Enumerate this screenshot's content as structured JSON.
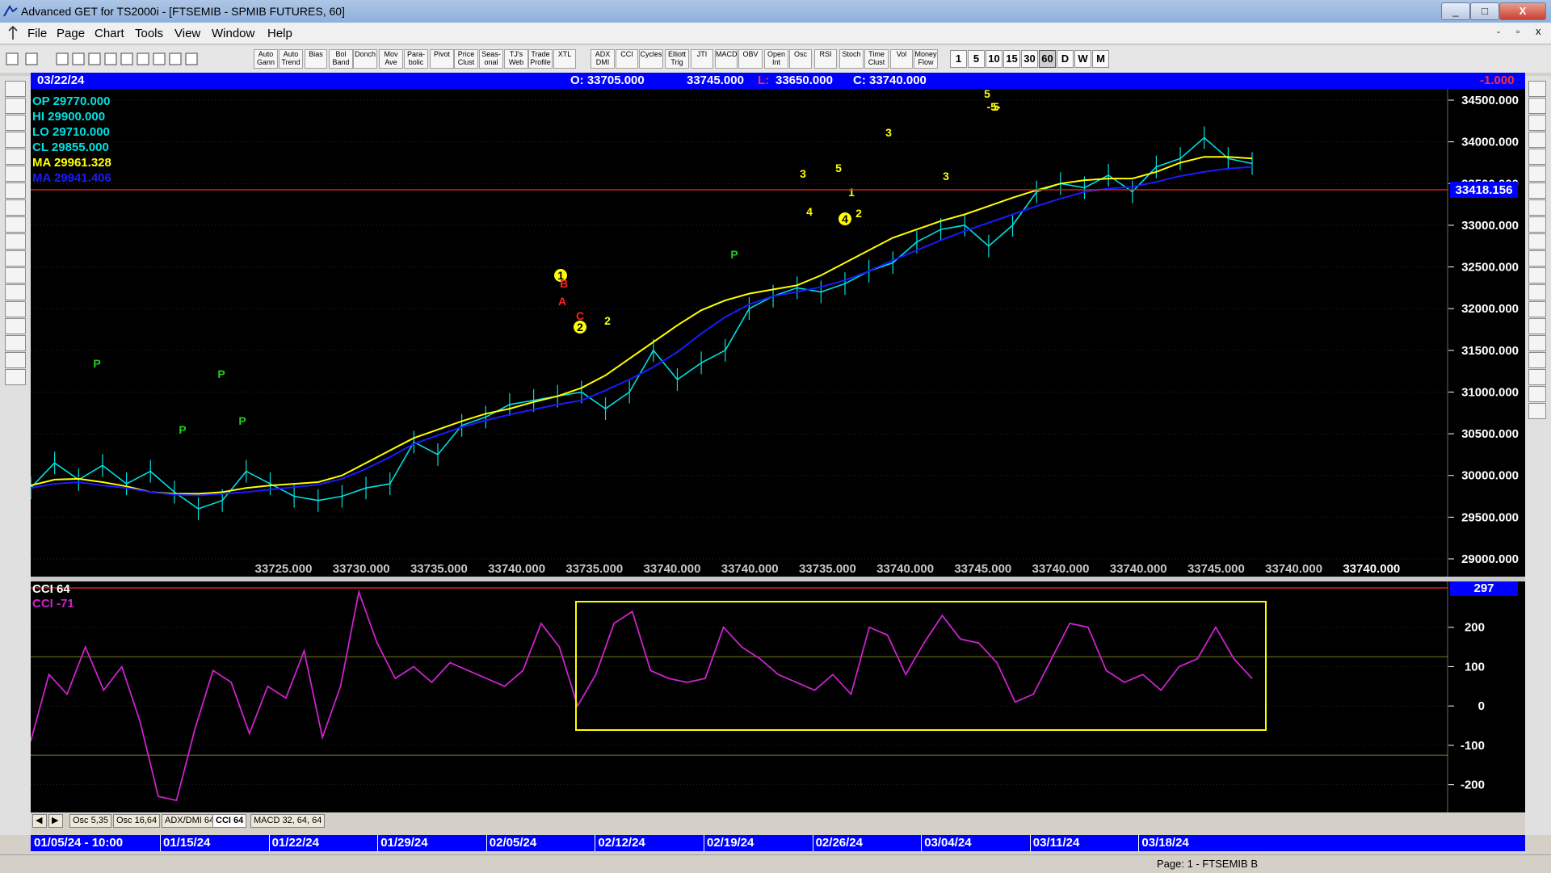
{
  "window": {
    "title": "Advanced GET for TS2000i - [FTSEMIB - SPMIB FUTURES, 60]",
    "controls": [
      "_",
      "□",
      "X"
    ],
    "child_controls": [
      "-",
      "▫",
      "x"
    ]
  },
  "menu": {
    "items": [
      "File",
      "Page",
      "Chart",
      "Tools",
      "View",
      "Window",
      "Help"
    ]
  },
  "toolbar": {
    "study_buttons": [
      "Auto Gann",
      "Auto Trend",
      "Bias",
      "Bol Band",
      "Donch",
      "Mov Ave",
      "Para- bolic",
      "Pivot",
      "Price Clust",
      "Seas- onal",
      "TJ's Web",
      "Trade Profile",
      "XTL",
      "ADX DMI",
      "CCI",
      "Cycles",
      "Elliott Trig",
      "JTI",
      "MACD",
      "OBV",
      "Open Int",
      "Osc",
      "RSI",
      "Stoch",
      "Time Clust",
      "Vol",
      "Money Flow"
    ],
    "intervals": [
      "1",
      "5",
      "10",
      "15",
      "30",
      "60",
      "D",
      "W",
      "M"
    ],
    "active_interval": "60"
  },
  "infobar": {
    "date": "03/22/24",
    "open": "O: 33705.000",
    "high": "33745.000",
    "low_label": "L:",
    "low": "33650.000",
    "close": "C: 33740.000",
    "change": "-1.000"
  },
  "legend": {
    "op": "OP  29770.000",
    "hi": "HI   29900.000",
    "lo": "LO  29710.000",
    "cl": "CL  29855.000",
    "ma1": "MA  29961.328",
    "ma2": "MA  29941.406"
  },
  "price_marker": "33418.156",
  "bottom_values": [
    "33725.000",
    "33730.000",
    "33735.000",
    "33740.000",
    "33735.000",
    "33740.000",
    "33740.000",
    "33735.000",
    "33740.000",
    "33745.000",
    "33740.000",
    "33740.000",
    "33745.000",
    "33740.000",
    "33740.000"
  ],
  "wave_labels": [
    "P",
    "P",
    "P",
    "P",
    "P",
    "1",
    "A",
    "B",
    "C",
    "2",
    "2",
    "3",
    "4",
    "3",
    "5",
    "4",
    "1",
    "2",
    "3",
    "4",
    "5",
    "5",
    "-5-"
  ],
  "osc_info": {
    "title": "CCI 64",
    "value": "CCI  -71",
    "marker": "297"
  },
  "tabs": [
    "Osc 5,35",
    "Osc 16,64",
    "ADX/DMI 64",
    "CCI 64",
    "MACD 32, 64, 64"
  ],
  "active_tab": "CCI 64",
  "dates": [
    "01/05/24 - 10:00",
    "01/15/24",
    "01/22/24",
    "01/29/24",
    "02/05/24",
    "02/12/24",
    "02/19/24",
    "02/26/24",
    "03/04/24",
    "03/11/24",
    "03/18/24"
  ],
  "status": "Page: 1 - FTSEMIB B",
  "colors": {
    "price": "#00e0e0",
    "ma_fast": "#ffff00",
    "ma_slow": "#1a1aff",
    "cci": "#cc22cc",
    "waves": "#ffff00",
    "pivots": "#22cc22",
    "abc": "#ff2222",
    "blue_bar": "#0000ff"
  },
  "chart_data": [
    {
      "type": "line",
      "ylim": [
        29000,
        34500
      ],
      "yticks": [
        "34500.000",
        "34000.000",
        "33500.000",
        "33000.000",
        "32500.000",
        "32000.000",
        "31500.000",
        "31000.000",
        "30500.000",
        "30000.000",
        "29500.000",
        "29000.000"
      ],
      "series": [
        {
          "values": [
            29850,
            30150,
            29950,
            30120,
            29900,
            30050,
            29800,
            29600,
            29700,
            30050,
            29900,
            29750,
            29700,
            29750,
            29850,
            29900,
            30400,
            30250,
            30600,
            30700,
            30850,
            30900,
            30950,
            31000,
            30800,
            31000,
            31500,
            31150,
            31350,
            31500,
            32000,
            32150,
            32250,
            32200,
            32300,
            32450,
            32550,
            32800,
            32950,
            33000,
            32750,
            33000,
            33400,
            33500,
            33450,
            33600,
            33400,
            33700,
            33800,
            34050,
            33800,
            33740
          ]
        },
        {
          "values": [
            29880,
            29950,
            29960,
            29920,
            29870,
            29800,
            29780,
            29780,
            29800,
            29850,
            29880,
            29900,
            29920,
            30000,
            30150,
            30300,
            30450,
            30550,
            30650,
            30740,
            30800,
            30880,
            30950,
            31050,
            31200,
            31400,
            31600,
            31800,
            31980,
            32100,
            32180,
            32230,
            32280,
            32400,
            32550,
            32700,
            32850,
            32950,
            33050,
            33130,
            33230,
            33330,
            33420,
            33500,
            33540,
            33560,
            33560,
            33640,
            33750,
            33820,
            33820,
            33800
          ]
        },
        {
          "values": [
            29850,
            29900,
            29920,
            29880,
            29850,
            29800,
            29770,
            29760,
            29780,
            29800,
            29830,
            29860,
            29890,
            29960,
            30080,
            30220,
            30380,
            30480,
            30580,
            30660,
            30730,
            30790,
            30850,
            30900,
            31020,
            31150,
            31300,
            31480,
            31700,
            31900,
            32050,
            32150,
            32200,
            32260,
            32340,
            32450,
            32580,
            32700,
            32820,
            32930,
            33030,
            33130,
            33230,
            33320,
            33400,
            33440,
            33460,
            33520,
            33590,
            33640,
            33680,
            33700
          ]
        }
      ]
    },
    {
      "type": "line",
      "ylim": [
        -250,
        300
      ],
      "yticks": [
        "200",
        "100",
        "0",
        "-100",
        "-200"
      ],
      "series": [
        {
          "values": [
            -90,
            80,
            30,
            150,
            40,
            100,
            -40,
            -230,
            -240,
            -60,
            90,
            60,
            -70,
            50,
            20,
            140,
            -80,
            50,
            290,
            160,
            70,
            100,
            60,
            110,
            90,
            70,
            50,
            90,
            210,
            150,
            0,
            80,
            210,
            240,
            90,
            70,
            60,
            70,
            200,
            150,
            120,
            80,
            60,
            40,
            80,
            30,
            200,
            180,
            80,
            160,
            230,
            170,
            160,
            110,
            10,
            30,
            120,
            210,
            200,
            90,
            60,
            80,
            40,
            100,
            120,
            200,
            120,
            70
          ]
        }
      ]
    }
  ]
}
